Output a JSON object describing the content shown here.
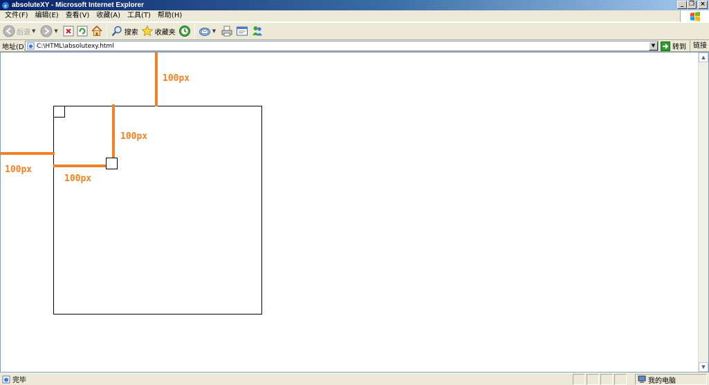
{
  "window": {
    "title": "absoluteXY - Microsoft Internet Explorer"
  },
  "menu": {
    "items": [
      "文件(F)",
      "编辑(E)",
      "查看(V)",
      "收藏(A)",
      "工具(T)",
      "帮助(H)"
    ]
  },
  "toolbar": {
    "back_label": "后退",
    "search_label": "搜索",
    "favorites_label": "收藏夹"
  },
  "address": {
    "label": "地址(D)",
    "value": "C:\\HTML\\absolutexy.html",
    "go_label": "转到",
    "links_label": "链接"
  },
  "content": {
    "label_top": "100px",
    "label_inner_top": "100px",
    "label_left": "100px",
    "label_inner_left": "100px",
    "accent_color": "#f58023"
  },
  "status": {
    "text": "完毕",
    "zone": "我的电脑"
  }
}
